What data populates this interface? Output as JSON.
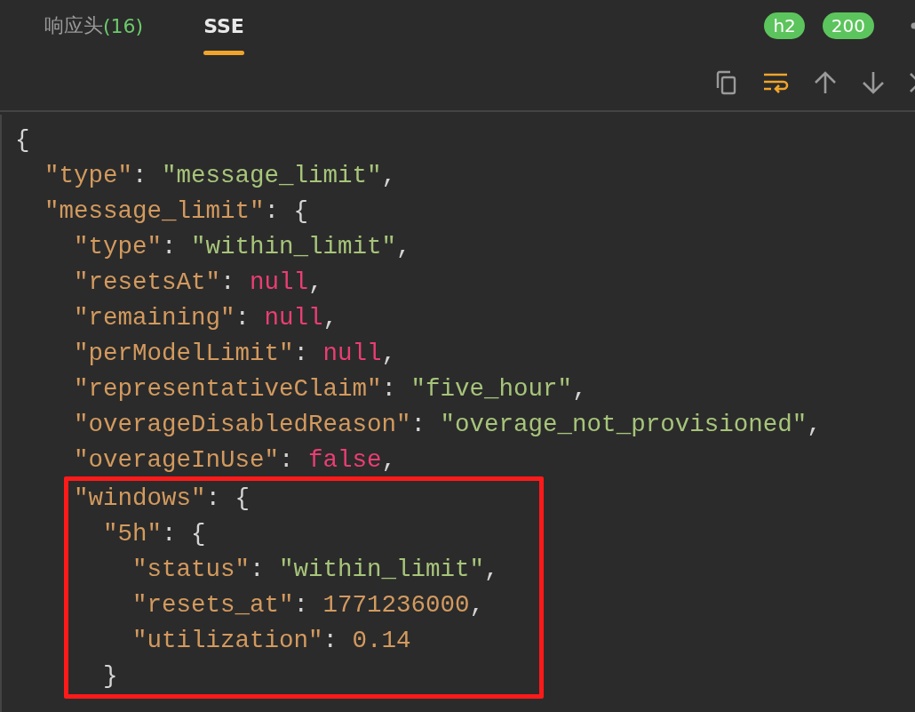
{
  "tabs": [
    {
      "label": "响应头",
      "count": "(16)",
      "selected": false
    },
    {
      "label": "SSE",
      "selected": true
    }
  ],
  "badges": [
    "h2",
    "200"
  ],
  "toolbar": [
    {
      "kind": "copy",
      "on": false
    },
    {
      "kind": "wrap",
      "on": true
    },
    {
      "kind": "up",
      "on": false
    },
    {
      "kind": "down",
      "on": false
    },
    {
      "kind": "close",
      "on": false
    }
  ],
  "code_lines": [
    {
      "highlighted": false,
      "tokens": [
        {
          "kind": "punct",
          "text": "{"
        }
      ]
    },
    {
      "highlighted": false,
      "tokens": [
        {
          "kind": "key",
          "text": "  \"type\""
        },
        {
          "kind": "punct",
          "text": ": "
        },
        {
          "kind": "string",
          "text": "\"message_limit\""
        },
        {
          "kind": "punct",
          "text": ","
        }
      ]
    },
    {
      "highlighted": false,
      "tokens": [
        {
          "kind": "key",
          "text": "  \"message_limit\""
        },
        {
          "kind": "punct",
          "text": ": {"
        }
      ]
    },
    {
      "highlighted": false,
      "tokens": [
        {
          "kind": "key",
          "text": "    \"type\""
        },
        {
          "kind": "punct",
          "text": ": "
        },
        {
          "kind": "string",
          "text": "\"within_limit\""
        },
        {
          "kind": "punct",
          "text": ","
        }
      ]
    },
    {
      "highlighted": false,
      "tokens": [
        {
          "kind": "key",
          "text": "    \"resetsAt\""
        },
        {
          "kind": "punct",
          "text": ": "
        },
        {
          "kind": "literal",
          "text": "null"
        },
        {
          "kind": "punct",
          "text": ","
        }
      ]
    },
    {
      "highlighted": false,
      "tokens": [
        {
          "kind": "key",
          "text": "    \"remaining\""
        },
        {
          "kind": "punct",
          "text": ": "
        },
        {
          "kind": "literal",
          "text": "null"
        },
        {
          "kind": "punct",
          "text": ","
        }
      ]
    },
    {
      "highlighted": false,
      "tokens": [
        {
          "kind": "key",
          "text": "    \"perModelLimit\""
        },
        {
          "kind": "punct",
          "text": ": "
        },
        {
          "kind": "literal",
          "text": "null"
        },
        {
          "kind": "punct",
          "text": ","
        }
      ]
    },
    {
      "highlighted": false,
      "tokens": [
        {
          "kind": "key",
          "text": "    \"representativeClaim\""
        },
        {
          "kind": "punct",
          "text": ": "
        },
        {
          "kind": "string",
          "text": "\"five_hour\""
        },
        {
          "kind": "punct",
          "text": ","
        }
      ]
    },
    {
      "highlighted": false,
      "tokens": [
        {
          "kind": "key",
          "text": "    \"overageDisabledReason\""
        },
        {
          "kind": "punct",
          "text": ": "
        },
        {
          "kind": "string",
          "text": "\"overage_not_provisioned\""
        },
        {
          "kind": "punct",
          "text": ","
        }
      ]
    },
    {
      "highlighted": false,
      "tokens": [
        {
          "kind": "key",
          "text": "    \"overageInUse\""
        },
        {
          "kind": "punct",
          "text": ": "
        },
        {
          "kind": "literal",
          "text": "false"
        },
        {
          "kind": "punct",
          "text": ","
        }
      ]
    },
    {
      "highlighted": true,
      "tokens": [
        {
          "kind": "key",
          "text": "    \"windows\""
        },
        {
          "kind": "punct",
          "text": ": {"
        }
      ]
    },
    {
      "highlighted": true,
      "tokens": [
        {
          "kind": "key",
          "text": "      \"5h\""
        },
        {
          "kind": "punct",
          "text": ": {"
        }
      ]
    },
    {
      "highlighted": true,
      "tokens": [
        {
          "kind": "key",
          "text": "        \"status\""
        },
        {
          "kind": "punct",
          "text": ": "
        },
        {
          "kind": "string",
          "text": "\"within_limit\""
        },
        {
          "kind": "punct",
          "text": ","
        }
      ]
    },
    {
      "highlighted": true,
      "tokens": [
        {
          "kind": "key",
          "text": "        \"resets_at\""
        },
        {
          "kind": "punct",
          "text": ": "
        },
        {
          "kind": "number",
          "text": "1771236000"
        },
        {
          "kind": "punct",
          "text": ","
        }
      ]
    },
    {
      "highlighted": true,
      "tokens": [
        {
          "kind": "key",
          "text": "        \"utilization\""
        },
        {
          "kind": "punct",
          "text": ": "
        },
        {
          "kind": "number",
          "text": "0.14"
        }
      ]
    },
    {
      "highlighted": true,
      "tokens": [
        {
          "kind": "punct",
          "text": "      }"
        }
      ]
    }
  ]
}
